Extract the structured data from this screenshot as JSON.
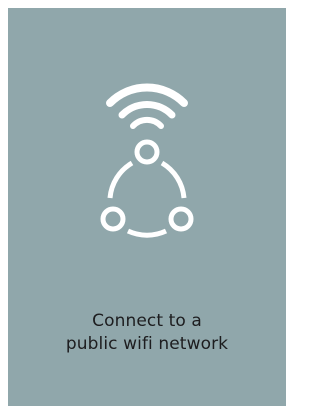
{
  "card": {
    "background": "#90a7ab",
    "icon": "public-wifi-network-icon",
    "caption": {
      "line1": "Connect to a",
      "line2": "public wifi network"
    }
  }
}
